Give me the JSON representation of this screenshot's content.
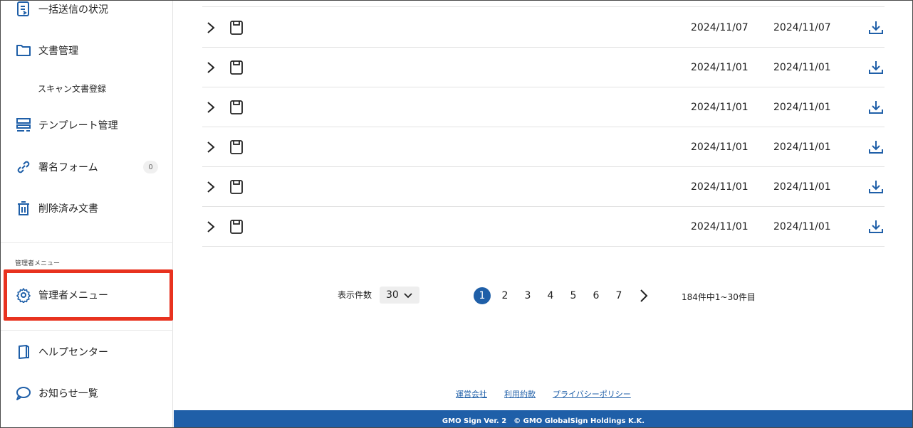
{
  "sidebar": {
    "items": [
      {
        "label": "一括送信の状況"
      },
      {
        "label": "文書管理"
      },
      {
        "label": "スキャン文書登録"
      },
      {
        "label": "テンプレート管理"
      },
      {
        "label": "署名フォーム",
        "badge": "0"
      },
      {
        "label": "削除済み文書"
      }
    ],
    "admin_section_label": "管理者メニュー",
    "admin_item": {
      "label": "管理者メニュー"
    },
    "help_items": [
      {
        "label": "ヘルプセンター"
      },
      {
        "label": "お知らせ一覧"
      }
    ]
  },
  "table": {
    "rows": [
      {
        "date1": "2024/11/07",
        "date2": "2024/11/07"
      },
      {
        "date1": "2024/11/01",
        "date2": "2024/11/01"
      },
      {
        "date1": "2024/11/01",
        "date2": "2024/11/01"
      },
      {
        "date1": "2024/11/01",
        "date2": "2024/11/01"
      },
      {
        "date1": "2024/11/01",
        "date2": "2024/11/01"
      },
      {
        "date1": "2024/11/01",
        "date2": "2024/11/01"
      }
    ]
  },
  "pagination": {
    "per_page_label": "表示件数",
    "per_page_value": "30",
    "pages": [
      "1",
      "2",
      "3",
      "4",
      "5",
      "6",
      "7"
    ],
    "active_page": "1",
    "info": "184件中1~30件目"
  },
  "footer": {
    "links": [
      "運営会社",
      "利用約款",
      "プライバシーポリシー"
    ],
    "copyright": "GMO Sign Ver. 2　© GMO GlobalSign Holdings K.K."
  },
  "colors": {
    "accent": "#1f5fa8",
    "highlight": "#e8321f"
  }
}
